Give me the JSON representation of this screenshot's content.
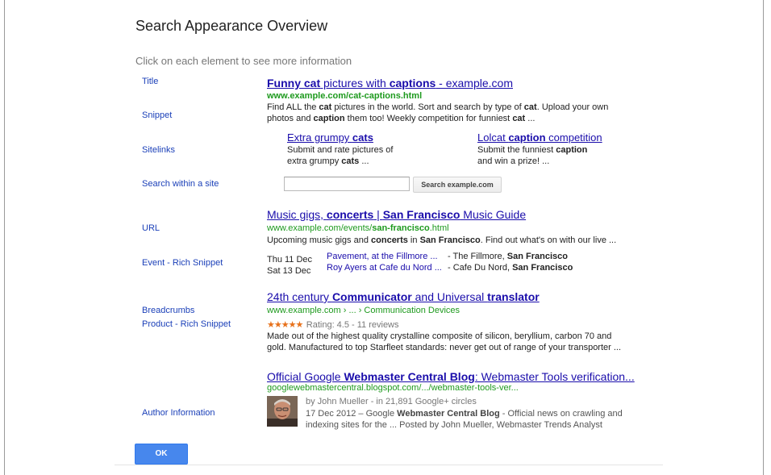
{
  "dialog": {
    "title": "Search Appearance Overview",
    "instruction": "Click on each element to see more information",
    "ok_label": "OK"
  },
  "labels": {
    "title": "Title",
    "snippet": "Snippet",
    "sitelinks": "Sitelinks",
    "search_within": "Search within a site",
    "url": "URL",
    "event": "Event - Rich Snippet",
    "breadcrumbs": "Breadcrumbs",
    "product": "Product - Rich Snippet",
    "author": "Author Information"
  },
  "result1": {
    "title_pre": "Funny cat",
    "title_mid": " pictures with ",
    "title_bold": "captions",
    "title_post": " - example.com",
    "url": "www.example.com/cat-captions.html",
    "snip1_a": "Find ALL the ",
    "snip1_b": "cat",
    "snip1_c": " pictures in the world. Sort and search by type of ",
    "snip1_d": "cat",
    "snip1_e": ". Upload your own",
    "snip2_a": "photos and ",
    "snip2_b": "caption",
    "snip2_c": " them too! Weekly competition for funniest ",
    "snip2_d": "cat",
    "snip2_e": " ...",
    "sitelinks": [
      {
        "title_pre": "Extra grumpy ",
        "title_bold": "cats",
        "title_post": "",
        "desc1": "Submit and rate pictures of",
        "desc2_pre": "extra grumpy ",
        "desc2_bold": "cats",
        "desc2_post": " ..."
      },
      {
        "title_pre": "Lolcat ",
        "title_bold": "caption",
        "title_post": " competition",
        "desc1_pre": "Submit the funniest ",
        "desc1_bold": "caption",
        "desc2": "and win a prize! ..."
      }
    ],
    "search_button": "Search example.com",
    "search_value": ""
  },
  "result2": {
    "title_a": "Music gigs, ",
    "title_b": "concerts",
    "title_c": " | ",
    "title_d": "San Francisco",
    "title_e": " Music Guide",
    "url_a": "www.example.com/events/",
    "url_b": "san-francisco",
    "url_c": ".html",
    "snip_a": "Upcoming music gigs and ",
    "snip_b": "concerts",
    "snip_c": " in ",
    "snip_d": "San Francisco",
    "snip_e": ". Find out what's on with our live ...",
    "events": [
      {
        "date": "Thu 11 Dec",
        "link": "Pavement, at the Fillmore ...",
        "rest_a": " - The Fillmore, ",
        "rest_b": "San Francisco"
      },
      {
        "date": "Sat 13 Dec",
        "link": "Roy Ayers at Cafe du Nord ...",
        "rest_a": " - Cafe Du Nord, ",
        "rest_b": "San Francisco"
      }
    ]
  },
  "result3": {
    "title_a": "24th century ",
    "title_b": "Communicator",
    "title_c": " and Universal ",
    "title_d": "translator",
    "breadcrumb": "www.example.com › ... › Communication Devices",
    "stars": "★★★★★",
    "rating_value": 4.5,
    "rating_text": "Rating: 4.5 - 11 reviews",
    "snip1": "Made out of the highest quality crystalline composite of silicon, beryllium, carbon 70 and",
    "snip2": "gold. Manufactured to top Starfleet standards: never get out of range of your transporter ..."
  },
  "result4": {
    "title_a": "Official Google ",
    "title_b": "Webmaster Central Blog",
    "title_c": ": Webmaster Tools verification...",
    "url": "googlewebmastercentral.blogspot.com/.../webmaster-tools-ver...",
    "author_line": "by John Mueller - in 21,891 Google+ circles",
    "snip1_a": "17 Dec 2012 – Google ",
    "snip1_b": "Webmaster Central Blog",
    "snip1_c": " - Official news on crawling and",
    "snip2": "indexing  sites for the ... Posted by John Mueller, Webmaster Trends Analyst"
  },
  "colors": {
    "link": "#1a0dab",
    "url_green": "#1e9a1e",
    "label_blue": "#1a3fb8",
    "ok_button": "#4787ed",
    "star": "#e7711b"
  },
  "icons": {
    "search_within": "text-input",
    "rating": "star-icon",
    "author": "avatar-photo"
  }
}
